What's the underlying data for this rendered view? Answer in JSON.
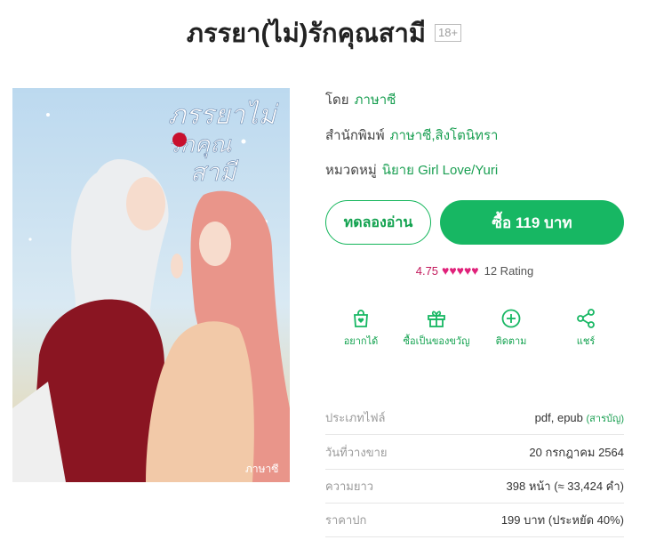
{
  "book": {
    "title": "ภรรยา(ไม่)รักคุณสามี",
    "age_rating": "18+",
    "cover_title_line1": "ภรรยาไม่",
    "cover_title_line2": "รักคุณ",
    "cover_title_line3": "สามี",
    "cover_signature": "ภาษาซี"
  },
  "meta": {
    "author_label": "โดย",
    "author": "ภาษาซี",
    "publisher_label": "สำนักพิมพ์",
    "publisher": "ภาษาซี,สิงโตนิทรา",
    "category_label": "หมวดหมู่",
    "category": "นิยาย Girl Love/Yuri"
  },
  "buttons": {
    "trial": "ทดลองอ่าน",
    "buy": "ซื้อ 119 บาท"
  },
  "rating": {
    "score": "4.75",
    "hearts": "♥♥♥♥♥",
    "count": "12 Rating"
  },
  "actions": [
    {
      "label": "อยากได้",
      "icon": "wishlist-bag-icon"
    },
    {
      "label": "ซื้อเป็นของขวัญ",
      "icon": "gift-icon"
    },
    {
      "label": "ติดตาม",
      "icon": "plus-circle-icon"
    },
    {
      "label": "แชร์",
      "icon": "share-icon"
    }
  ],
  "specs": [
    {
      "key": "ประเภทไฟล์",
      "value": "pdf, epub",
      "link": "(สารบัญ)"
    },
    {
      "key": "วันที่วางขาย",
      "value": "20 กรกฎาคม 2564",
      "link": ""
    },
    {
      "key": "ความยาว",
      "value": "398 หน้า (≈ 33,424 คำ)",
      "link": ""
    },
    {
      "key": "ราคาปก",
      "value": "199 บาท (ประหยัด 40%)",
      "link": ""
    }
  ],
  "colors": {
    "accent": "#17b763",
    "link": "#1a9f52",
    "heart": "#e0217a"
  }
}
